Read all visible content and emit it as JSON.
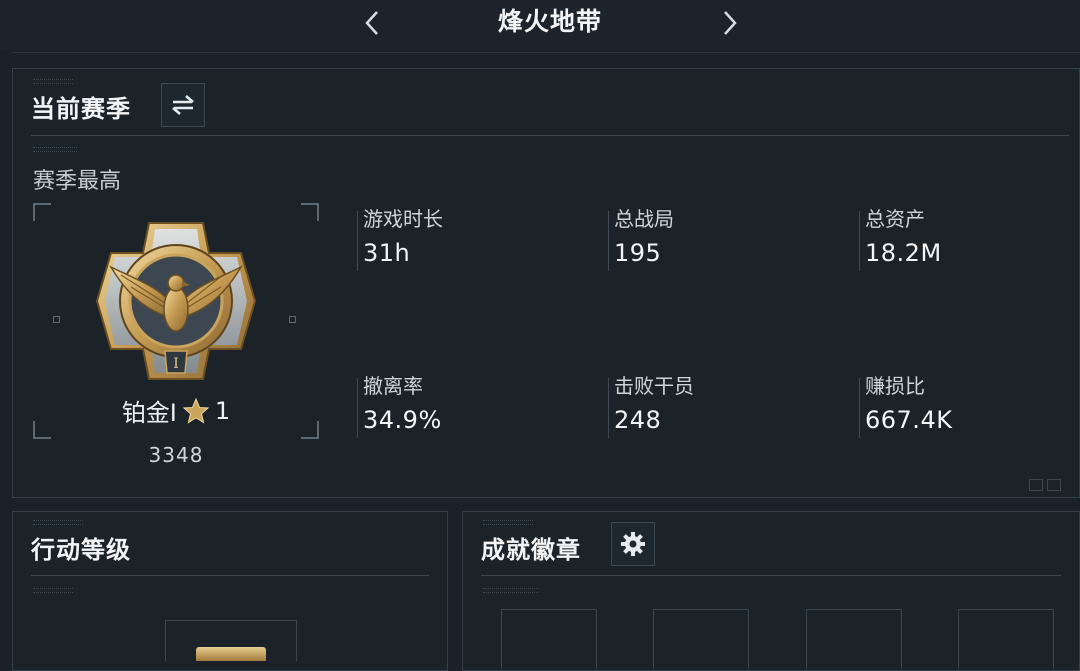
{
  "header": {
    "title": "烽火地带",
    "prev_icon": "chevron-left-icon",
    "next_icon": "chevron-right-icon"
  },
  "season_panel": {
    "title": "当前赛季",
    "switch_icon": "swap-icon",
    "subtitle": "赛季最高",
    "rank": {
      "name": "铂金Ⅰ",
      "stars": "1",
      "star_icon": "star-icon",
      "score": "3348",
      "emblem_numeral": "I"
    },
    "stats": [
      {
        "label": "游戏时长",
        "value": "31h"
      },
      {
        "label": "总战局",
        "value": "195"
      },
      {
        "label": "总资产",
        "value": "18.2M"
      },
      {
        "label": "撤离率",
        "value": "34.9%"
      },
      {
        "label": "击败干员",
        "value": "248"
      },
      {
        "label": "赚损比",
        "value": "667.4K"
      }
    ]
  },
  "level_panel": {
    "title": "行动等级"
  },
  "badges_panel": {
    "title": "成就徽章",
    "settings_icon": "gear-icon"
  },
  "colors": {
    "background": "#1a2128",
    "panel_border": "#33404a",
    "gold": "#c9a45c",
    "text": "#e9edf0"
  }
}
